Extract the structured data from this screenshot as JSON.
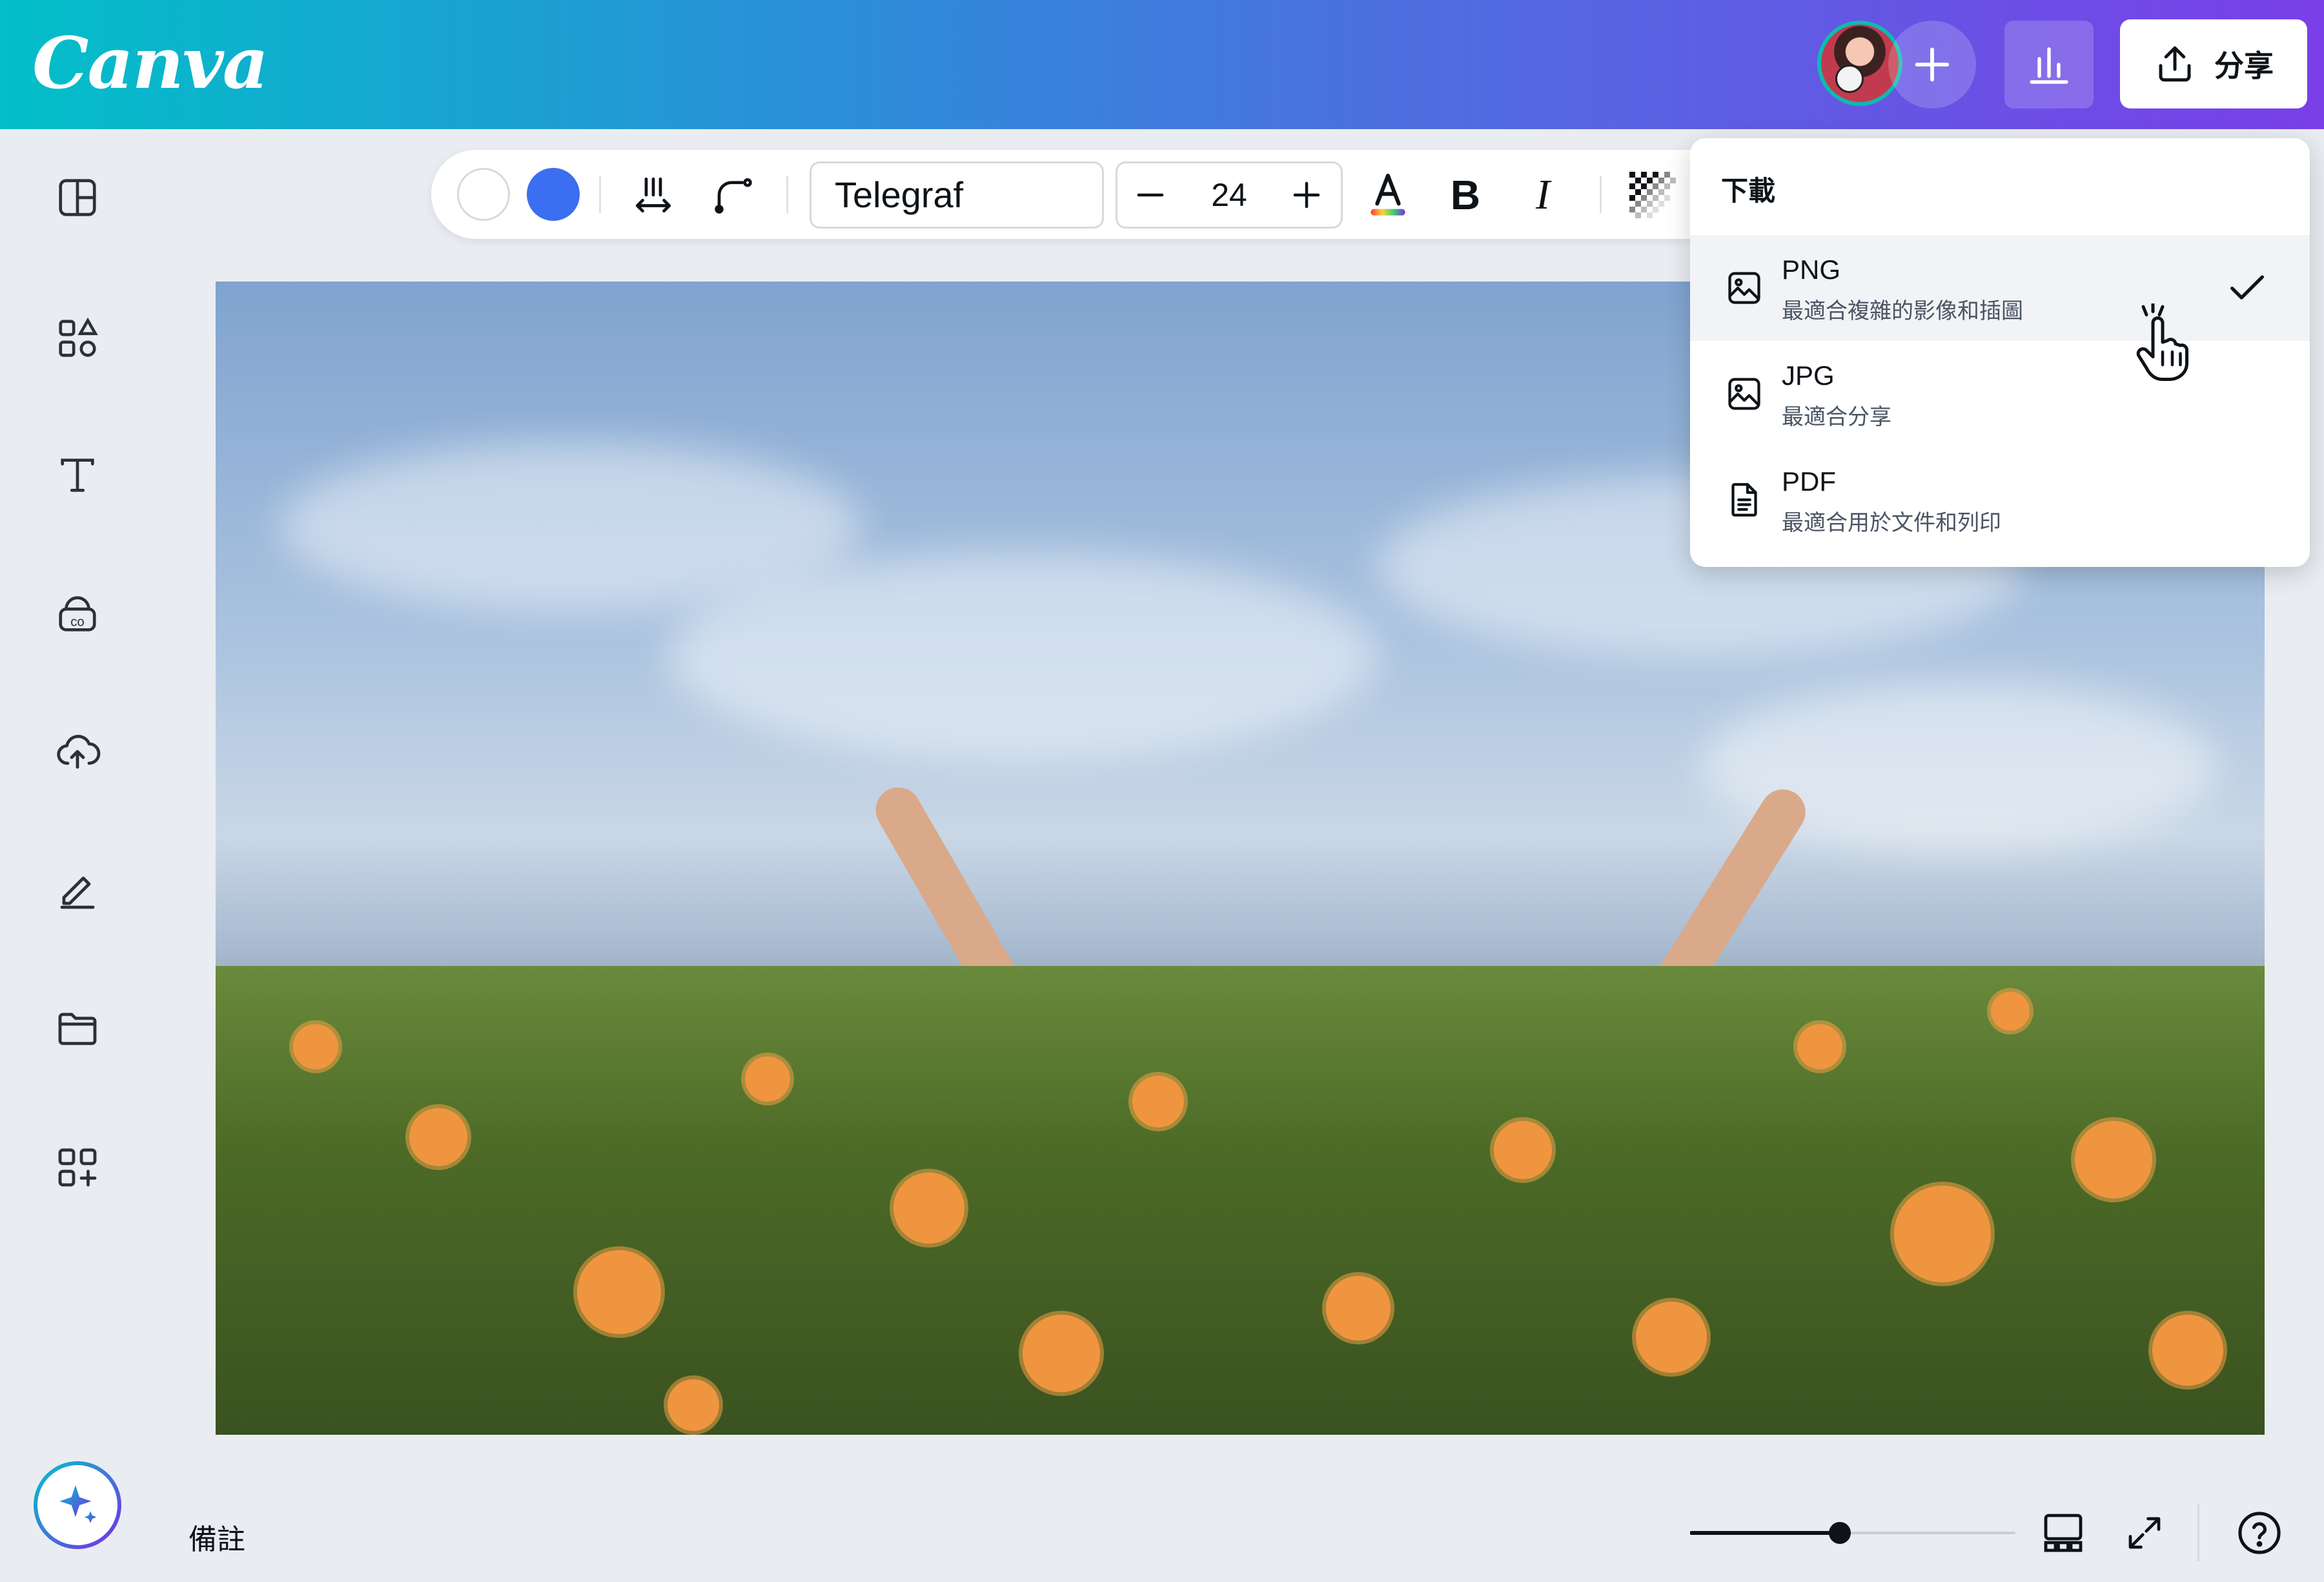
{
  "app": {
    "logo_text": "Canva"
  },
  "header": {
    "share_label": "分享",
    "buttons": [
      "add-collaborator",
      "insights",
      "share"
    ]
  },
  "sidebar": {
    "items": [
      "design-panel",
      "elements",
      "text",
      "brand",
      "uploads",
      "draw",
      "projects",
      "apps"
    ],
    "magic_button": "magic-sparkle"
  },
  "toolbar": {
    "font_name": "Telegraf",
    "font_size": "24",
    "text_color_sample": "A",
    "bold_label": "B",
    "italic_label": "I",
    "swatch_colors": [
      "#ffffff",
      "#3b6ef0"
    ]
  },
  "download_menu": {
    "title": "下載",
    "items": [
      {
        "label": "PNG",
        "description": "最適合複雜的影像和插圖",
        "selected": true,
        "icon": "image-icon"
      },
      {
        "label": "JPG",
        "description": "最適合分享",
        "selected": false,
        "icon": "image-icon"
      },
      {
        "label": "PDF",
        "description": "最適合用於文件和列印",
        "selected": false,
        "icon": "document-icon"
      }
    ]
  },
  "footer": {
    "notes_label": "備註",
    "zoom_level_fraction": 0.46
  },
  "colors": {
    "accent_teal": "#00c4cc",
    "accent_purple": "#7d2ae8",
    "swatch_blue": "#3b6ef0"
  }
}
